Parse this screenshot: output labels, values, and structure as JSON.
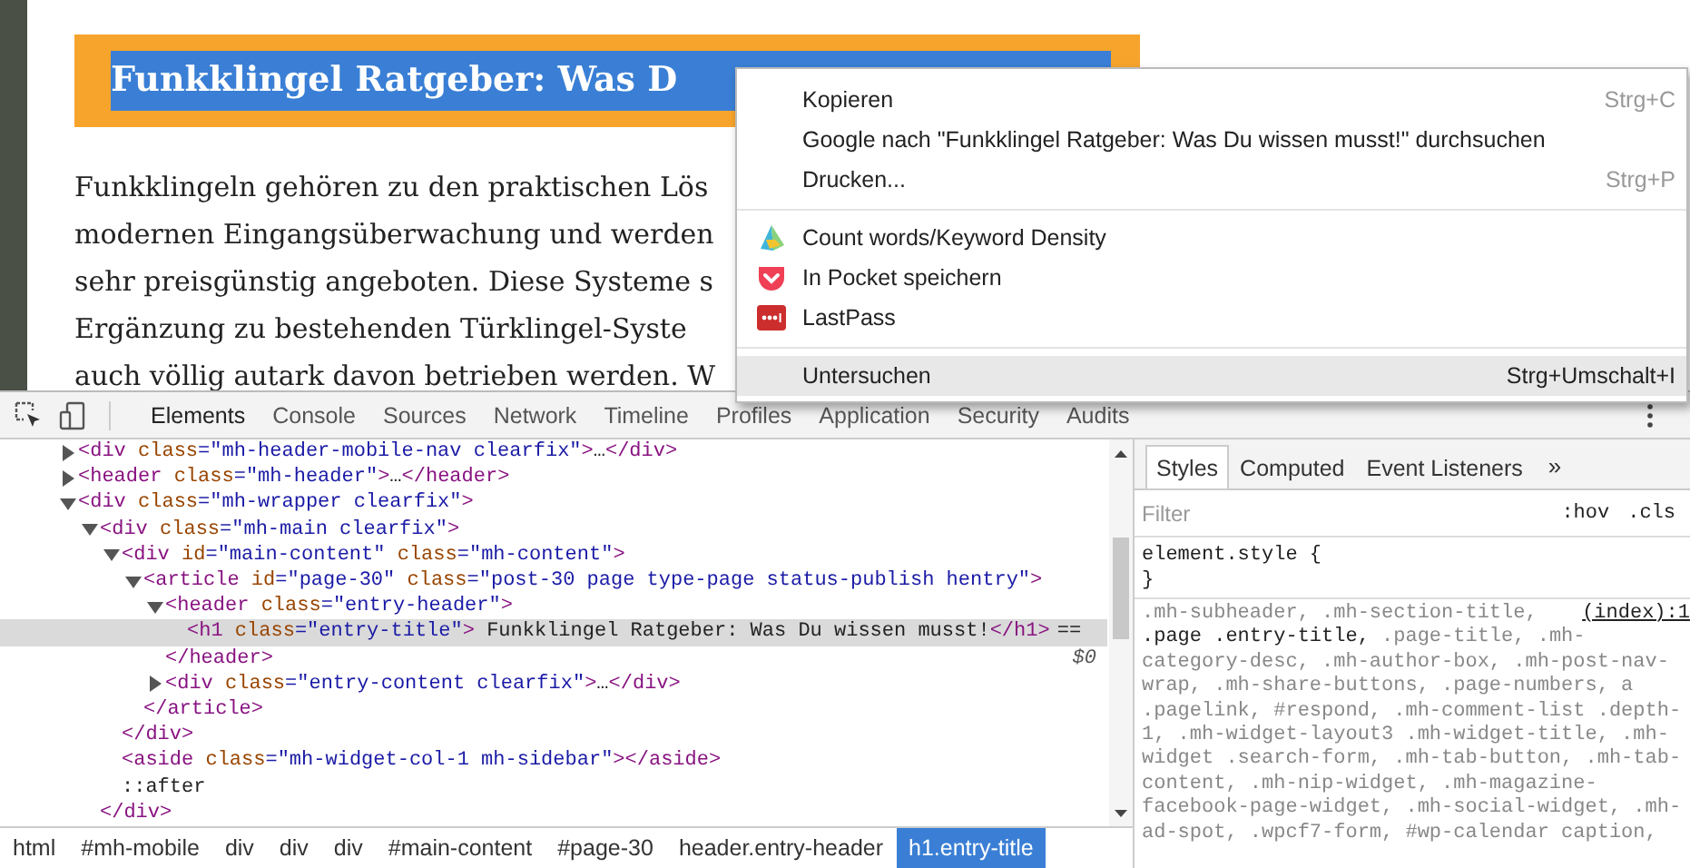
{
  "page": {
    "title": "Funkklingel Ratgeber: Was D",
    "paragraph_lines": [
      "Funkklingeln gehören zu den praktischen Lös",
      "modernen Eingangsüberwachung und werden",
      "sehr preisgünstig angeboten. Diese Systeme s",
      "Ergänzung zu bestehenden Türklingel-Syste",
      "auch völlig autark davon betrieben werden. W"
    ]
  },
  "context_menu": {
    "items": [
      {
        "kind": "item",
        "label": "Kopieren",
        "shortcut": "Strg+C",
        "selected": false
      },
      {
        "kind": "item",
        "label": "Google nach \"Funkklingel Ratgeber: Was Du wissen musst!\" durchsuchen",
        "selected": false
      },
      {
        "kind": "item",
        "label": "Drucken...",
        "shortcut": "Strg+P",
        "selected": false
      },
      {
        "kind": "separator"
      },
      {
        "kind": "extension",
        "label": "Count words/Keyword Density",
        "selected": false
      },
      {
        "kind": "extension",
        "label": "In Pocket speichern",
        "selected": false
      },
      {
        "kind": "extension",
        "label": "LastPass",
        "selected": false
      },
      {
        "kind": "separator"
      },
      {
        "kind": "item",
        "label": "Untersuchen",
        "shortcut": "Strg+Umschalt+I",
        "selected": true
      }
    ]
  },
  "devtools": {
    "tabs": [
      {
        "label": "Elements",
        "selected": true
      },
      {
        "label": "Console",
        "selected": false
      },
      {
        "label": "Sources",
        "selected": false
      },
      {
        "label": "Network",
        "selected": false
      },
      {
        "label": "Timeline",
        "selected": false
      },
      {
        "label": "Profiles",
        "selected": false
      },
      {
        "label": "Application",
        "selected": false
      },
      {
        "label": "Security",
        "selected": false
      },
      {
        "label": "Audits",
        "selected": false
      }
    ],
    "dom": {
      "nodes": [
        {
          "kind": "node",
          "line": "<div class=\"mh-header-mobile-nav clearfix\">…</div>",
          "expanded": false,
          "selected": false
        },
        {
          "kind": "node",
          "line": "<header class=\"mh-header\">…</header>",
          "expanded": false,
          "selected": false
        },
        {
          "kind": "node",
          "line": "<div class=\"mh-wrapper clearfix\">",
          "expanded": true,
          "selected": false,
          "children": [
            {
              "kind": "node",
              "line": "<div class=\"mh-main clearfix\">",
              "expanded": true,
              "selected": false,
              "closing": "</div>",
              "children": [
                {
                  "kind": "node",
                  "line": "<div id=\"main-content\" class=\"mh-content\">",
                  "expanded": true,
                  "selected": false,
                  "closing": "</div>",
                  "children": [
                    {
                      "kind": "node",
                      "line": "<article id=\"page-30\" class=\"post-30 page type-page status-publish hentry\">",
                      "expanded": true,
                      "selected": false,
                      "closing": "</article>",
                      "children": [
                        {
                          "kind": "node",
                          "line": "<header class=\"entry-header\">",
                          "expanded": true,
                          "selected": false,
                          "closing": "</header>",
                          "children": [
                            {
                              "kind": "leaf",
                              "line": "<h1 class=\"entry-title\"> Funkklingel Ratgeber: Was Du wissen musst!</h1>",
                              "selected": true,
                              "suffix": "==",
                              "console_ref": "$0"
                            }
                          ]
                        },
                        {
                          "kind": "node",
                          "line": "<div class=\"entry-content clearfix\">…</div>",
                          "expanded": false,
                          "selected": false
                        }
                      ]
                    }
                  ]
                },
                {
                  "kind": "leaf",
                  "line": "<aside class=\"mh-widget-col-1 mh-sidebar\"></aside>",
                  "selected": false
                },
                {
                  "kind": "leaf",
                  "line": "::after",
                  "selected": false
                }
              ]
            }
          ]
        }
      ]
    },
    "breadcrumbs": [
      {
        "label": "html",
        "selected": false
      },
      {
        "label": "#mh-mobile",
        "selected": false
      },
      {
        "label": "div",
        "selected": false
      },
      {
        "label": "div",
        "selected": false
      },
      {
        "label": "div",
        "selected": false
      },
      {
        "label": "#main-content",
        "selected": false
      },
      {
        "label": "#page-30",
        "selected": false
      },
      {
        "label": "header.entry-header",
        "selected": false
      },
      {
        "label": "h1.entry-title",
        "selected": true
      }
    ],
    "styles": {
      "tabs": [
        {
          "label": "Styles",
          "selected": true
        },
        {
          "label": "Computed",
          "selected": false
        },
        {
          "label": "Event Listeners",
          "selected": false
        }
      ],
      "more": "»",
      "filter": {
        "placeholder": "Filter"
      },
      "toggles": [
        ":hov",
        ".cls"
      ],
      "element_style": {
        "open": "element.style {",
        "close": "}"
      },
      "rule": {
        "source": "(index):1",
        "first_line": ".mh-subheader, .mh-section-title,",
        "selectors": "**.page .entry-title,** .page-title, .mh-category-desc, .mh-author-box, .mh-post-nav-wrap, .mh-share-buttons, .page-numbers, a .pagelink, #respond, .mh-comment-list .depth-1, .mh-widget-layout3 .mh-widget-title, .mh-widget .search-form, .mh-tab-button, .mh-tab-content, .mh-nip-widget, .mh-magazine-facebook-page-widget, .mh-social-widget, .mh-ad-spot, .wpcf7-form, #wp-calendar caption,"
      }
    }
  }
}
